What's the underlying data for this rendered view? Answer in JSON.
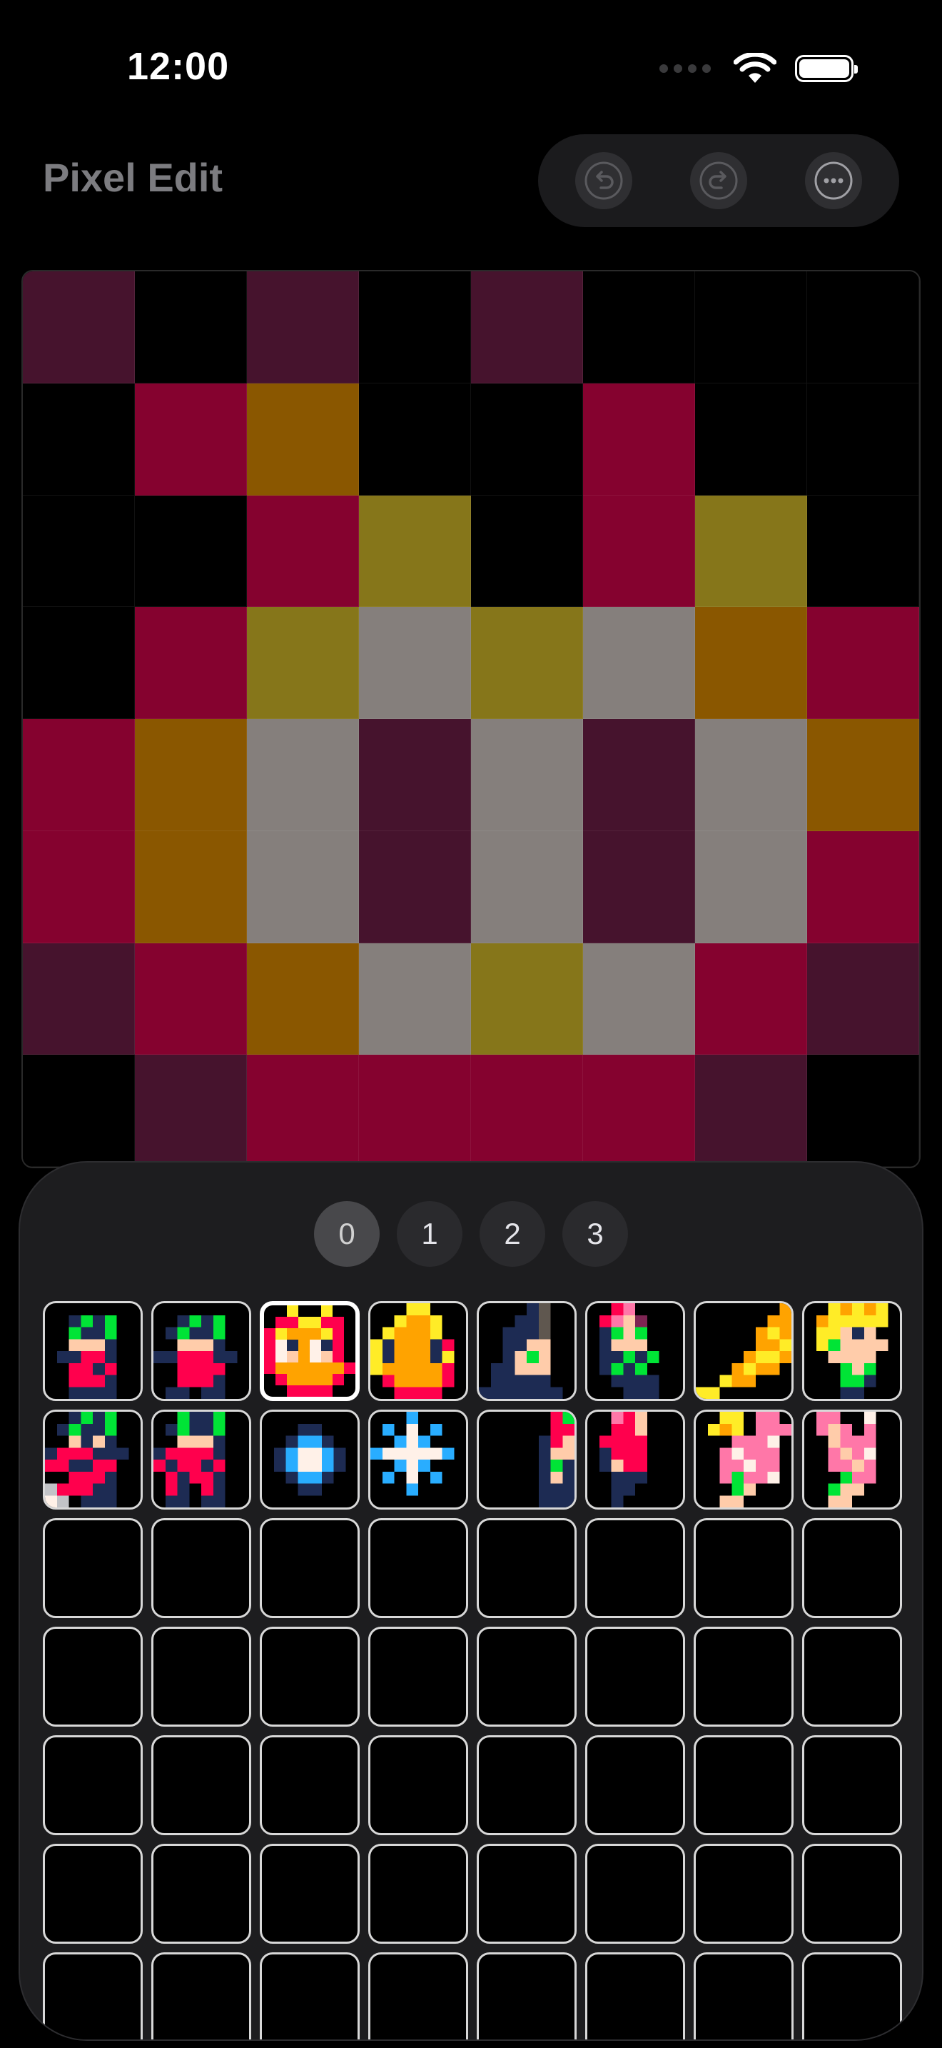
{
  "status_bar": {
    "time": "12:00"
  },
  "header": {
    "title": "Pixel Edit"
  },
  "toolbar": {
    "buttons": [
      {
        "name": "undo-button",
        "icon": "undo-icon"
      },
      {
        "name": "redo-button",
        "icon": "redo-icon"
      },
      {
        "name": "more-button",
        "icon": "more-icon"
      }
    ]
  },
  "canvas": {
    "rows": [
      [
        "#46132d",
        "#000000",
        "#46132d",
        "#000000",
        "#46132d",
        "#000000",
        "#000000",
        "#000000"
      ],
      [
        "#000000",
        "#85022f",
        "#8a5700",
        "#000000",
        "#000000",
        "#85022f",
        "#000000",
        "#000000"
      ],
      [
        "#000000",
        "#000000",
        "#85022f",
        "#86761a",
        "#000000",
        "#85022f",
        "#86761a",
        "#000000"
      ],
      [
        "#000000",
        "#85022f",
        "#86761a",
        "#857f7c",
        "#86761a",
        "#857f7c",
        "#8a5700",
        "#85022f"
      ],
      [
        "#85022f",
        "#8a5700",
        "#857f7c",
        "#46132d",
        "#857f7c",
        "#46132d",
        "#857f7c",
        "#8a5700"
      ],
      [
        "#85022f",
        "#8a5700",
        "#857f7c",
        "#46132d",
        "#857f7c",
        "#46132d",
        "#857f7c",
        "#85022f"
      ],
      [
        "#46132d",
        "#85022f",
        "#8a5700",
        "#857f7c",
        "#86761a",
        "#857f7c",
        "#85022f",
        "#46132d"
      ],
      [
        "#000000",
        "#46132d",
        "#85022f",
        "#85022f",
        "#85022f",
        "#85022f",
        "#46132d",
        "#000000"
      ]
    ]
  },
  "pages": {
    "tabs": [
      "0",
      "1",
      "2",
      "3"
    ],
    "selected": "0"
  },
  "sprites": {
    "selected_index": 2,
    "palette": {
      ".": "#000000",
      "k": "#1d2b53",
      "r": "#ff004d",
      "g": "#00e436",
      "p": "#ffccaa",
      "w": "#fff1e8",
      "y": "#ffec27",
      "o": "#ffa300",
      "m": "#7e2553",
      "d": "#5f574f",
      "b": "#29adff",
      "l": "#ff77a8",
      "c": "#c2c3c7"
    },
    "slots": [
      [
        "........",
        "..kgkg..",
        "..gkkg..",
        "..pppk..",
        ".kkrrk..",
        "..rrkr..",
        "..rrrk..",
        "..kkkk.."
      ],
      [
        "........",
        "..kgkg..",
        ".kgkkg..",
        "..pppk..",
        "kkrrrkk.",
        "..rrrr..",
        "..rrrk..",
        ".kk.kk.."
      ],
      [
        "..y..y..",
        ".rryyrr.",
        "ryoooyr.",
        "rwkowkr.",
        "rwpowpr.",
        "roooooor",
        ".roooor.",
        "..rrrr.."
      ],
      [
        "...yy...",
        "..yooy..",
        ".yoooy..",
        "ykoookr.",
        "ykoooky.",
        "yooooor.",
        ".roooor.",
        "..rrrr.."
      ],
      [
        "....kd..",
        "...kkd..",
        "..kkkd..",
        "..kkpp..",
        "..kpgp..",
        ".kkppp..",
        ".kkkkk..",
        "kkkkkkk."
      ],
      [
        "..rl....",
        ".rlpm...",
        ".kgpg...",
        ".kppp...",
        ".kkgkg..",
        ".kgkg...",
        "..kkkk..",
        "...kkk.."
      ],
      [
        ".......o",
        "......oo",
        ".....oyo",
        ".....ooy",
        "....oyyo",
        "...oyoo.",
        "..yoo...",
        "yy......"
      ],
      [
        "..yoyoy.",
        ".oyyyyy.",
        ".yypkp..",
        ".ygpppp.",
        "..pppp..",
        "...gpg..",
        "...ggk..",
        "...kk..."
      ],
      [
        "..kgkg..",
        ".kgkkg..",
        "..pkpk..",
        "krrrkkk.",
        "rrkkrr..",
        "..rrrk..",
        "crrrkk..",
        "wc.kkk.."
      ],
      [
        "..gkkg..",
        ".kgkkg..",
        "..pppk..",
        "krrrrk..",
        "rkrrkr..",
        ".rkrrk..",
        ".rk.rk..",
        ".kk.kk.."
      ],
      [
        "........",
        "...kk...",
        "..kbbk..",
        ".kbwwbk.",
        ".kbwwbk.",
        "..kbbk..",
        "...kk...",
        "........"
      ],
      [
        "...b....",
        ".b.w.b..",
        "..bwb...",
        "bwwwwwb.",
        "..bwb...",
        ".b.w.b..",
        "...b....",
        "........"
      ],
      [
        "......rg",
        "......rr",
        ".....krp",
        ".....kpp",
        ".....kgk",
        ".....kpk",
        ".....kkk",
        ".....kkk"
      ],
      [
        "..lrp...",
        "..rrp...",
        ".rrrr...",
        ".krrr...",
        ".kprr...",
        "..kkk...",
        "..kk....",
        "..k....."
      ],
      [
        "..yy.ll.",
        ".yoy.lll",
        "...lllw.",
        "..lwlll.",
        "..llwll.",
        "..lgllw.",
        "...gp...",
        "..pp...."
      ],
      [
        ".ll..w..",
        ".lpl.l..",
        "..plll..",
        "..lplw..",
        "..llpl..",
        "...gll..",
        "..gpp...",
        "..pp...."
      ]
    ],
    "total_slots": 56
  }
}
